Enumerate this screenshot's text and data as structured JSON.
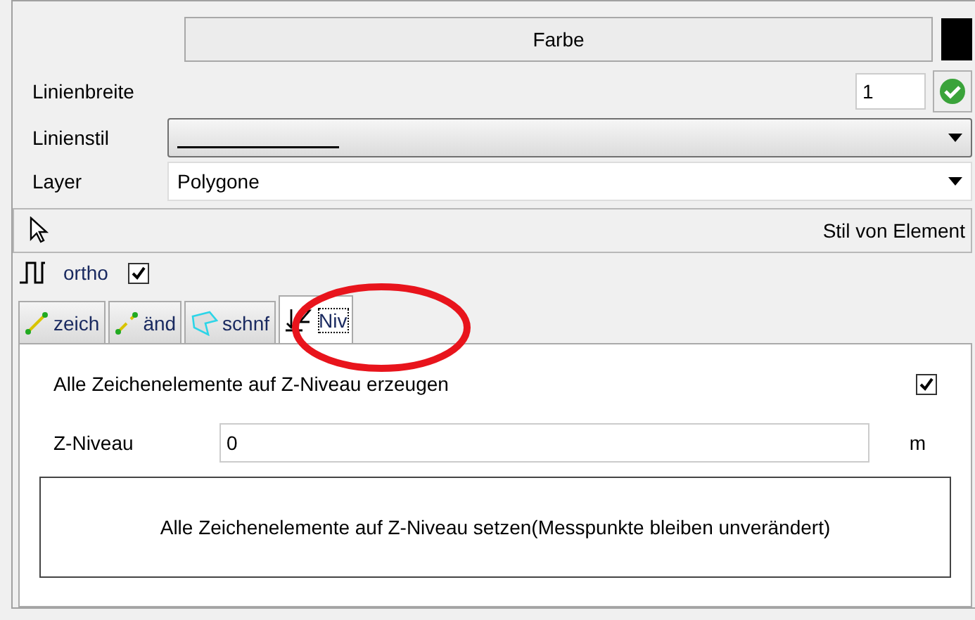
{
  "color_button": {
    "label": "Farbe",
    "color": "#000000"
  },
  "line_width": {
    "label": "Linienbreite",
    "value": "1"
  },
  "line_style": {
    "label": "Linienstil"
  },
  "layer": {
    "label": "Layer",
    "value": "Polygone"
  },
  "style_bar": {
    "label": "Stil von Element"
  },
  "ortho": {
    "label": "ortho",
    "checked": true
  },
  "tabs": [
    {
      "label": "zeich",
      "kind": "draw",
      "selected": false
    },
    {
      "label": "änd",
      "kind": "edit",
      "selected": false
    },
    {
      "label": "schnf",
      "kind": "hatch",
      "selected": false
    },
    {
      "label": "Niv",
      "kind": "level",
      "selected": true
    }
  ],
  "panel": {
    "create_label": "Alle Zeichenelemente auf Z-Niveau erzeugen",
    "create_checked": true,
    "z_label": "Z-Niveau",
    "z_value": "0",
    "unit": "m",
    "apply_button": "Alle Zeichenelemente auf Z-Niveau setzen(Messpunkte bleiben unverändert)"
  },
  "annotation": {
    "kind": "ellipse",
    "color": "#e8141c"
  }
}
